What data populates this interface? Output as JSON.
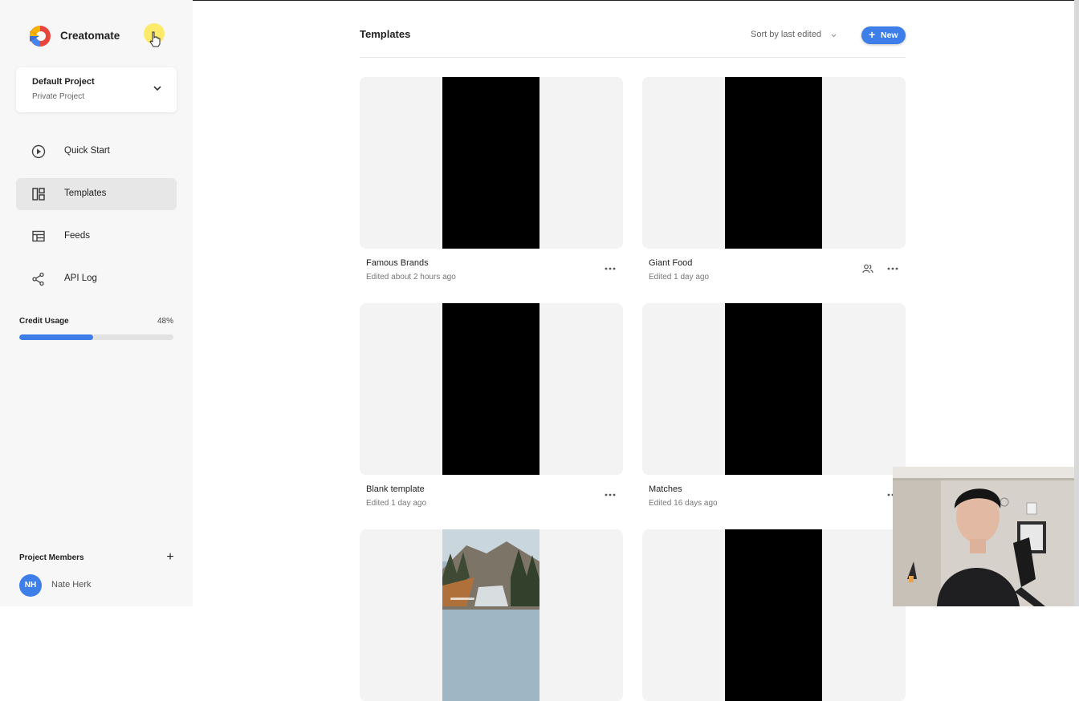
{
  "app": {
    "brand": "Creatomate"
  },
  "project": {
    "name": "Default Project",
    "subtitle": "Private Project"
  },
  "nav": [
    {
      "label": "Quick Start",
      "icon": "play-circle-icon",
      "active": false
    },
    {
      "label": "Templates",
      "icon": "templates-icon",
      "active": true
    },
    {
      "label": "Feeds",
      "icon": "feeds-table-icon",
      "active": false
    },
    {
      "label": "API Log",
      "icon": "share-nodes-icon",
      "active": false
    }
  ],
  "credit": {
    "label": "Credit Usage",
    "percent_text": "48%",
    "fraction": 0.48
  },
  "members": {
    "label": "Project Members",
    "add": "+",
    "items": [
      {
        "initials": "NH",
        "name": "Nate Herk"
      }
    ]
  },
  "main": {
    "title": "Templates",
    "sort_label": "Sort by last edited",
    "new_label": "New"
  },
  "templates": [
    {
      "name": "Famous Brands",
      "meta": "Edited about 2 hours ago",
      "shared": false
    },
    {
      "name": "Giant Food",
      "meta": "Edited 1 day ago",
      "shared": true
    },
    {
      "name": "Blank template",
      "meta": "Edited 1 day ago",
      "shared": false
    },
    {
      "name": "Matches",
      "meta": "Edited 16 days ago",
      "shared": false
    },
    {
      "name": "",
      "meta": "",
      "shared": false
    },
    {
      "name": "",
      "meta": "",
      "shared": false
    }
  ],
  "colors": {
    "accent": "#3e7ee8",
    "sidebar_bg": "#f7f7f7",
    "thumb_bg": "#f3f3f3"
  }
}
